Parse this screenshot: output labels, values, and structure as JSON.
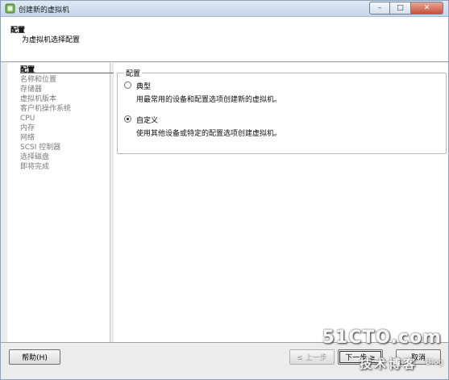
{
  "window": {
    "title": "创建新的虚拟机",
    "controls": {
      "minimize": "–",
      "maximize": "□",
      "close": "✕"
    }
  },
  "header": {
    "title": "配置",
    "subtitle": "为虚拟机选择配置"
  },
  "sidebar": {
    "items": [
      {
        "label": "配置",
        "active": true
      },
      {
        "label": "名称和位置",
        "active": false
      },
      {
        "label": "存储器",
        "active": false
      },
      {
        "label": "虚拟机版本",
        "active": false
      },
      {
        "label": "客户机操作系统",
        "active": false
      },
      {
        "label": "CPU",
        "active": false
      },
      {
        "label": "内存",
        "active": false
      },
      {
        "label": "网络",
        "active": false
      },
      {
        "label": "SCSI 控制器",
        "active": false
      },
      {
        "label": "选择磁盘",
        "active": false
      },
      {
        "label": "即将完成",
        "active": false
      }
    ]
  },
  "main": {
    "group_label": "配置",
    "options": [
      {
        "label": "典型",
        "description": "用最常用的设备和配置选项创建新的虚拟机。",
        "selected": false
      },
      {
        "label": "自定义",
        "description": "使用其他设备或特定的配置选项创建虚拟机。",
        "selected": true
      }
    ]
  },
  "footer": {
    "help": "帮助(H)",
    "back": "≤ 上一步",
    "next": "下一步 ≥",
    "cancel": "取消"
  },
  "watermark": {
    "main": "51CTO.com",
    "sub": "技术博客",
    "blog": "Blog"
  }
}
